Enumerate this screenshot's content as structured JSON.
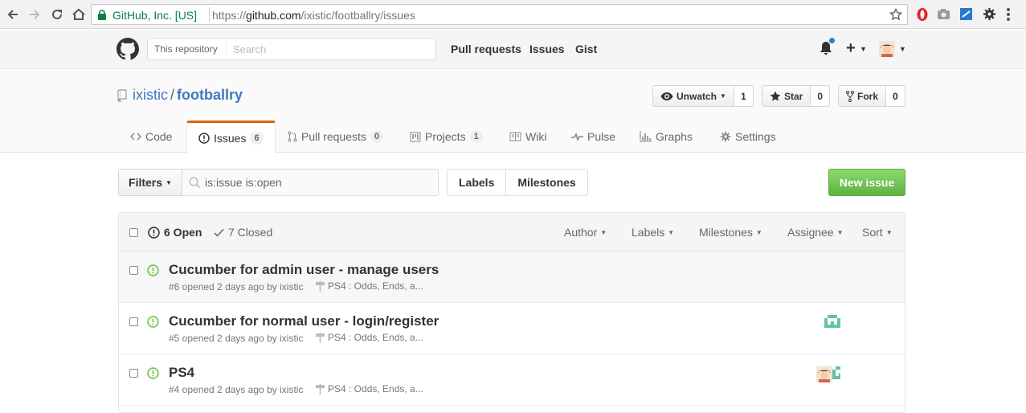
{
  "browser": {
    "secure_label": "GitHub, Inc. [US]",
    "url_prefix": "https://",
    "url_host": "github.com",
    "url_path": "/ixistic/footballry/issues",
    "icons": [
      "back-icon",
      "forward-icon",
      "reload-icon",
      "home-icon",
      "lock-icon",
      "bookmark-star-icon",
      "opera-icon",
      "camera-icon",
      "screenshot-icon",
      "settings-gear-icon",
      "menu-icon"
    ]
  },
  "header": {
    "scope_label": "This repository",
    "search_placeholder": "Search",
    "nav": [
      "Pull requests",
      "Issues",
      "Gist"
    ],
    "plus_label": "+"
  },
  "repo": {
    "owner": "ixistic",
    "separator": "/",
    "name": "footballry",
    "watch_label": "Unwatch",
    "watch_count": "1",
    "star_label": "Star",
    "star_count": "0",
    "fork_label": "Fork",
    "fork_count": "0"
  },
  "tabs": [
    {
      "label": "Code",
      "counter": ""
    },
    {
      "label": "Issues",
      "counter": "6"
    },
    {
      "label": "Pull requests",
      "counter": "0"
    },
    {
      "label": "Projects",
      "counter": "1"
    },
    {
      "label": "Wiki",
      "counter": ""
    },
    {
      "label": "Pulse",
      "counter": ""
    },
    {
      "label": "Graphs",
      "counter": ""
    },
    {
      "label": "Settings",
      "counter": ""
    }
  ],
  "subnav": {
    "filters_label": "Filters",
    "filter_query": "is:issue is:open",
    "labels_label": "Labels",
    "milestones_label": "Milestones",
    "new_issue_label": "New issue"
  },
  "table": {
    "open_label": "6 Open",
    "closed_label": "7 Closed",
    "filters": [
      "Author",
      "Labels",
      "Milestones",
      "Assignee",
      "Sort"
    ]
  },
  "issues": [
    {
      "title": "Cucumber for admin user - manage users",
      "meta": "#6 opened 2 days ago by ixistic",
      "milestone": "PS4 : Odds, Ends, a..."
    },
    {
      "title": "Cucumber for normal user - login/register",
      "meta": "#5 opened 2 days ago by ixistic",
      "milestone": "PS4 : Odds, Ends, a..."
    },
    {
      "title": "PS4",
      "meta": "#4 opened 2 days ago by ixistic",
      "milestone": "PS4 : Odds, Ends, a..."
    }
  ],
  "colors": {
    "link": "#4078c0",
    "tab_accent": "#d26911",
    "new_issue_green": "#60b044",
    "open_issue_green": "#6cc644",
    "secure_green": "#0b8043"
  }
}
